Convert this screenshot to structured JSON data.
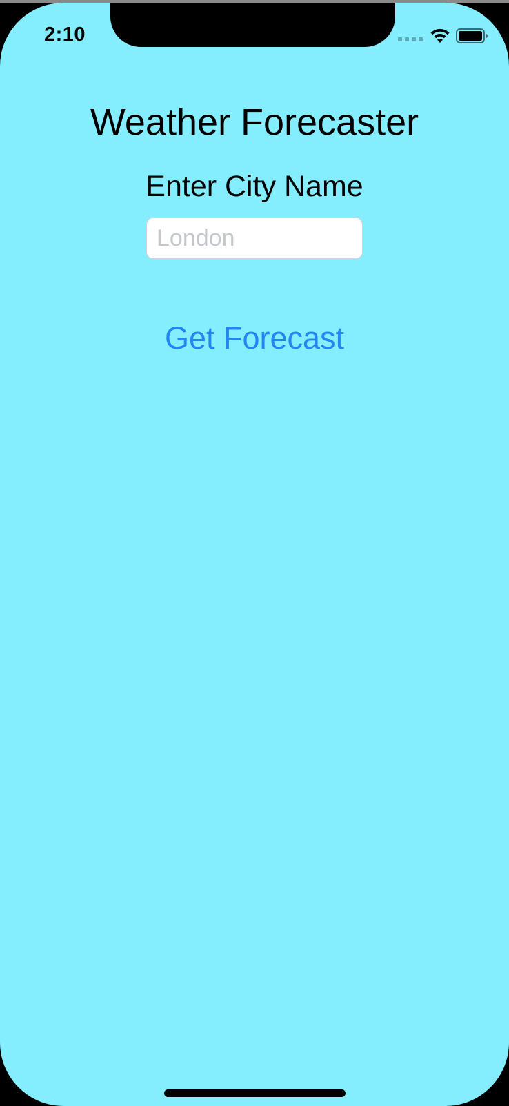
{
  "status_bar": {
    "time": "2:10",
    "icons": [
      "cellular-signal-icon",
      "wifi-icon",
      "battery-icon"
    ]
  },
  "app": {
    "title": "Weather Forecaster",
    "city_label": "Enter City Name",
    "city_input": {
      "value": "",
      "placeholder": "London"
    },
    "forecast_button_label": "Get Forecast"
  },
  "colors": {
    "background": "#85eefe",
    "accent": "#2285f3",
    "text": "#000000",
    "placeholder": "#c4c7cc"
  }
}
